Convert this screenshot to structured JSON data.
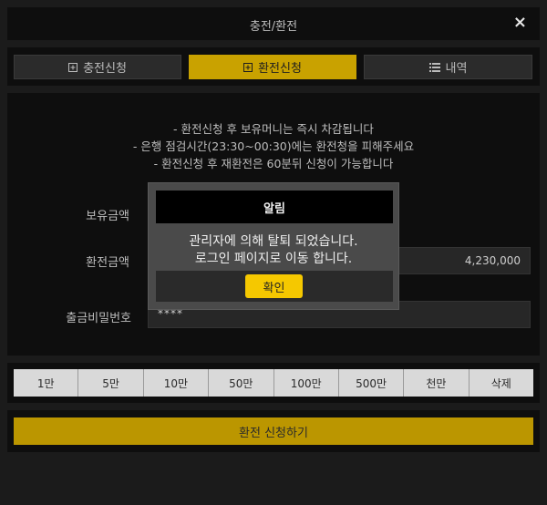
{
  "window": {
    "title": "충전/환전",
    "close_label": "×"
  },
  "tabs": [
    {
      "label": "충전신청",
      "icon": "plus-square-icon"
    },
    {
      "label": "환전신청",
      "icon": "plus-square-icon",
      "active": true
    },
    {
      "label": "내역",
      "icon": "list-icon"
    }
  ],
  "notice": {
    "line1": "- 환전신청 후 보유머니는 즉시 차감됩니다",
    "line2": "- 은행 점검시간(23:30~00:30)에는 환전청을 피해주세요",
    "line3": "- 환전신청 후 재환전은 60분뒤 신청이 가능합니다"
  },
  "form": {
    "balance_label": "보유금액",
    "exchange_label": "환전금액",
    "exchange_value": "4,230,000",
    "password_label": "출금비밀번호",
    "password_value": "****"
  },
  "amount_buttons": [
    "1만",
    "5만",
    "10만",
    "50만",
    "100만",
    "500만",
    "천만",
    "삭제"
  ],
  "submit_label": "환전 신청하기",
  "modal": {
    "title": "알림",
    "line1": "관리자에 의해 탈퇴 되었습니다.",
    "line2": "로그인 페이지로 이동 합니다.",
    "ok_label": "확인"
  },
  "colors": {
    "accent": "#c9a200",
    "ok_button": "#f5c800",
    "background": "#1b1b1b"
  }
}
